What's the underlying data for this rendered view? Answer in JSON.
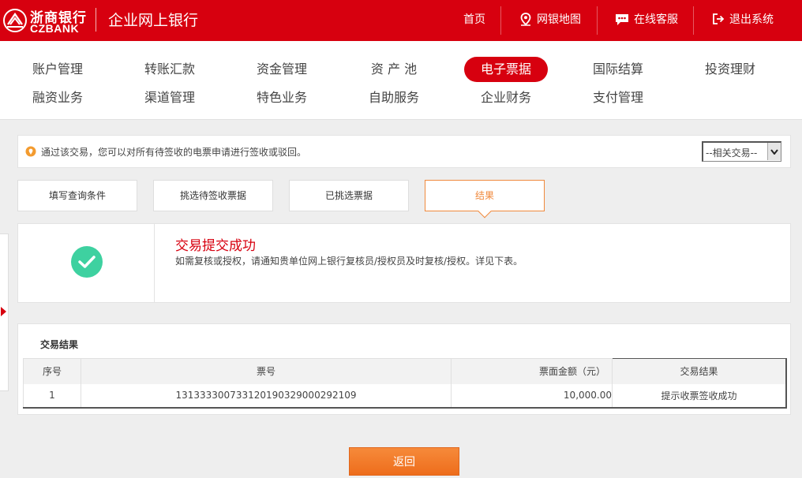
{
  "brand": {
    "name_cn": "浙商银行",
    "name_en": "CZBANK",
    "app_title": "企业网上银行"
  },
  "top_nav": {
    "home": "首页",
    "site_map": "网银地图",
    "online_service": "在线客服",
    "logout": "退出系统"
  },
  "menu": {
    "row1": [
      "账户管理",
      "转账汇款",
      "资金管理",
      "资 产 池",
      "电子票据",
      "国际结算",
      "投资理财"
    ],
    "row2": [
      "融资业务",
      "渠道管理",
      "特色业务",
      "自助服务",
      "企业财务",
      "支付管理"
    ],
    "active": "电子票据"
  },
  "notice": {
    "text": "通过该交易，您可以对所有待签收的电票申请进行签收或驳回。",
    "related_select": "--相关交易--"
  },
  "steps": [
    "填写查询条件",
    "挑选待签收票据",
    "已挑选票据",
    "结果"
  ],
  "success": {
    "title": "交易提交成功",
    "desc": "如需复核或授权，请通知贵单位网上银行复核员/授权员及时复核/授权。详见下表。"
  },
  "result": {
    "title": "交易结果",
    "columns": [
      "序号",
      "票号",
      "票面金额（元）",
      "交易结果"
    ],
    "rows": [
      [
        "1",
        "131333300733120190329000292109",
        "10,000.00",
        "提示收票签收成功"
      ]
    ]
  },
  "actions": {
    "back": "返回"
  },
  "colors": {
    "brand_red": "#d7000f",
    "accent_orange": "#f0893c",
    "success_green": "#3ed1a0"
  }
}
